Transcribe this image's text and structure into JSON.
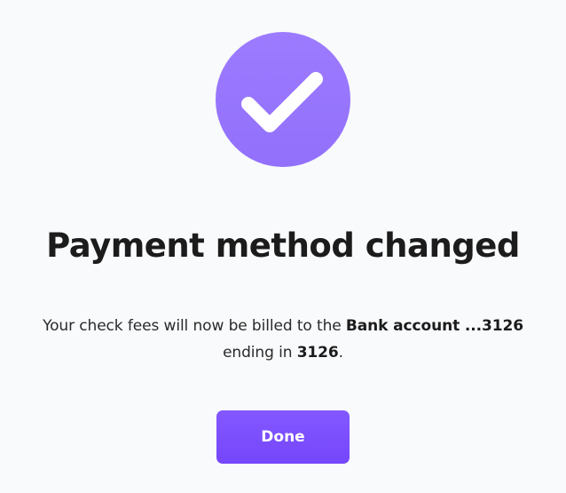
{
  "dialog": {
    "icon": "check-icon",
    "title": "Payment method changed",
    "message": {
      "line1_prefix": "Your check fees will now be billed to the ",
      "account_label": "Bank account ...3126",
      "line2_prefix": "ending in ",
      "account_ending": "3126",
      "line2_suffix": "."
    },
    "done_label": "Done"
  },
  "colors": {
    "background": "#f9fafc",
    "icon_circle": "#9a78ff",
    "button": "#7a4dfd",
    "button_text": "#ffffff",
    "title_text": "#1c1c1c"
  }
}
